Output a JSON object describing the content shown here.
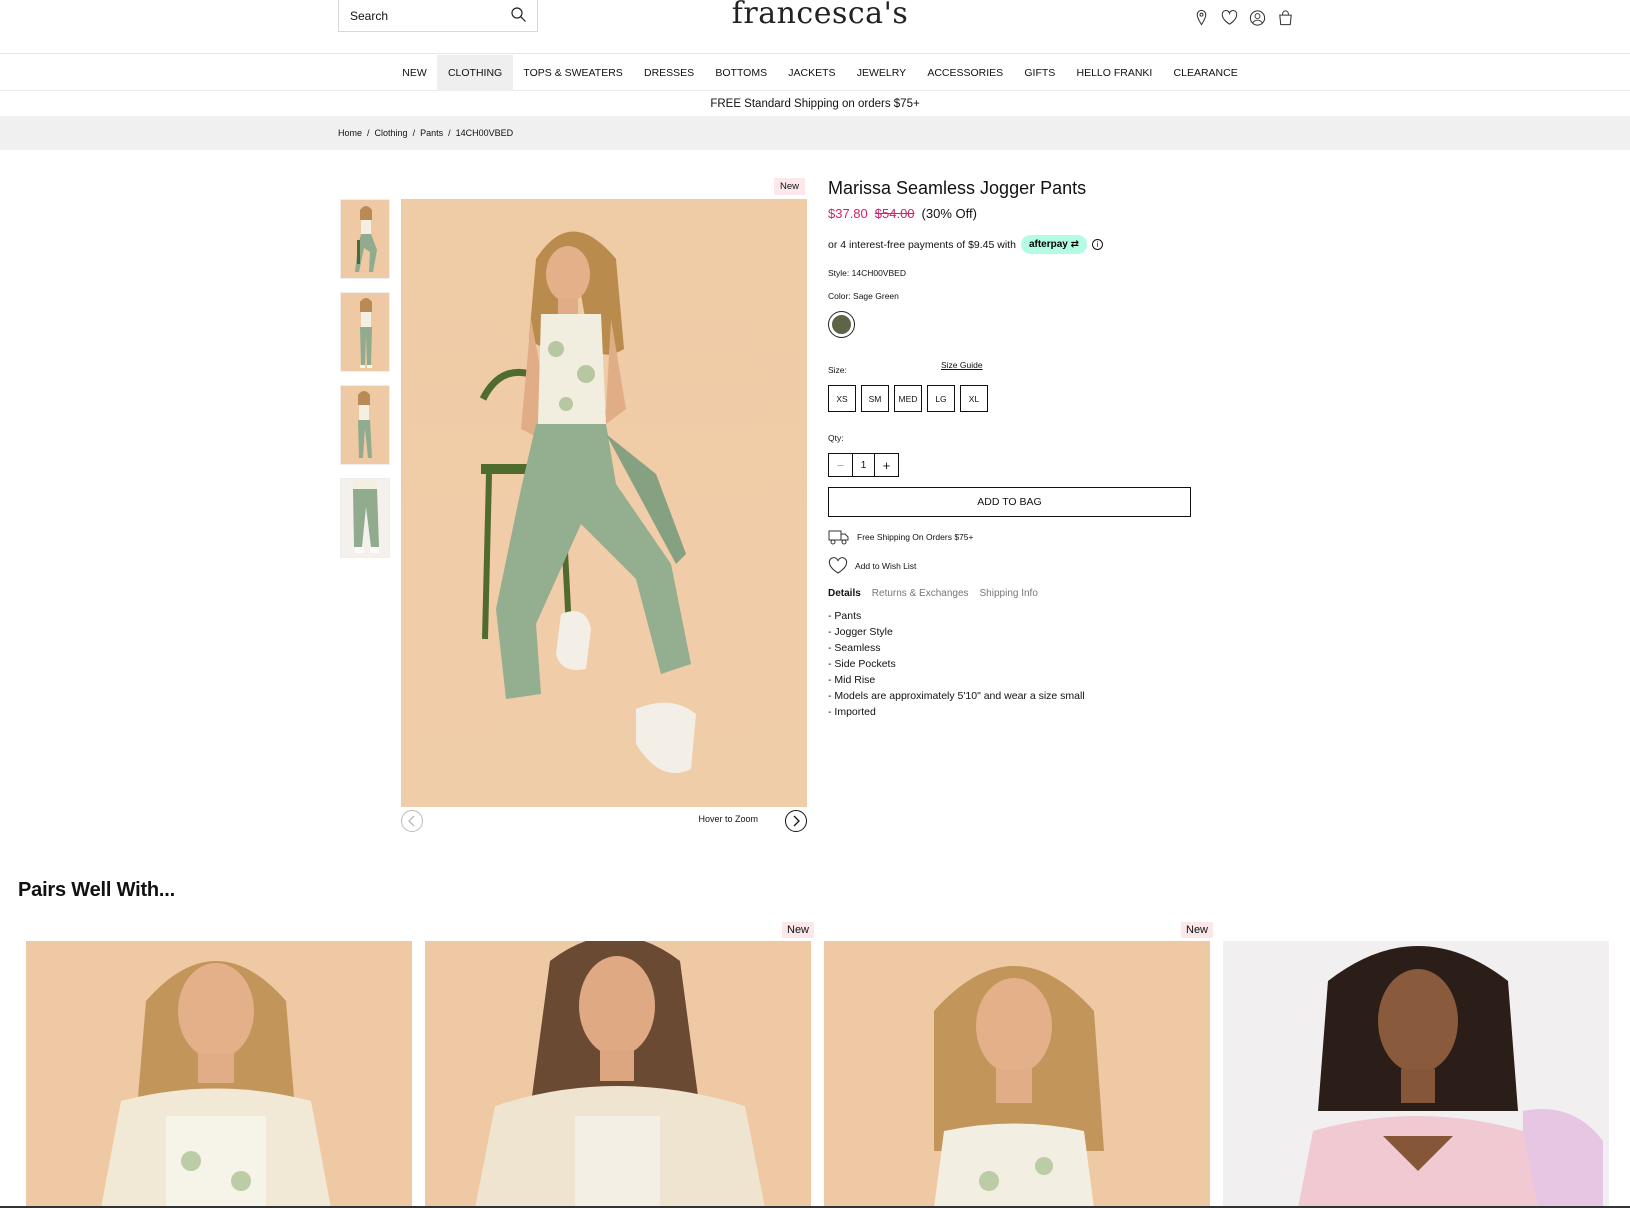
{
  "header": {
    "search_placeholder": "Search",
    "logo": "francesca's",
    "icons": [
      "location-icon",
      "heart-icon",
      "account-icon",
      "bag-icon"
    ]
  },
  "nav": {
    "items": [
      "NEW",
      "CLOTHING",
      "TOPS & SWEATERS",
      "DRESSES",
      "BOTTOMS",
      "JACKETS",
      "JEWELRY",
      "ACCESSORIES",
      "GIFTS",
      "HELLO FRANKI",
      "CLEARANCE"
    ],
    "active": "CLOTHING"
  },
  "promo": "FREE Standard Shipping on orders $75+",
  "breadcrumb": [
    "Home",
    "Clothing",
    "Pants",
    "14CH00VBED"
  ],
  "gallery": {
    "new_tag": "New",
    "hover_zoom": "Hover to Zoom",
    "thumb_count": 4
  },
  "product": {
    "title": "Marissa Seamless Jogger Pants",
    "sale_price": "$37.80",
    "original_price": "$54.00",
    "discount": "(30% Off)",
    "afterpay_text": "or 4 interest-free payments of $9.45 with",
    "afterpay_badge": "afterpay",
    "style": "Style: 14CH00VBED",
    "color": "Color: Sage Green",
    "swatch_color": "#5e6448",
    "size_label": "Size:",
    "size_guide": "Size Guide",
    "sizes": [
      "XS",
      "SM",
      "MED",
      "LG",
      "XL"
    ],
    "qty_label": "Qty:",
    "qty": "1",
    "add_to_bag": "ADD TO BAG",
    "free_shipping": "Free Shipping On Orders $75+",
    "wishlist": "Add to Wish List",
    "tabs": [
      "Details",
      "Returns & Exchanges",
      "Shipping Info"
    ],
    "details": [
      "- Pants",
      "- Jogger Style",
      "- Seamless",
      "- Side Pockets",
      "- Mid Rise",
      "- Models are approximately 5'10\" and wear a size small",
      "- Imported"
    ]
  },
  "pairs": {
    "title": "Pairs Well With...",
    "new_tag": "New"
  },
  "colors": {
    "sale": "#d6216a",
    "afterpay": "#b2fce4",
    "new_tag_bg": "#fce7ea",
    "photo_bg": "#efc9a3"
  }
}
